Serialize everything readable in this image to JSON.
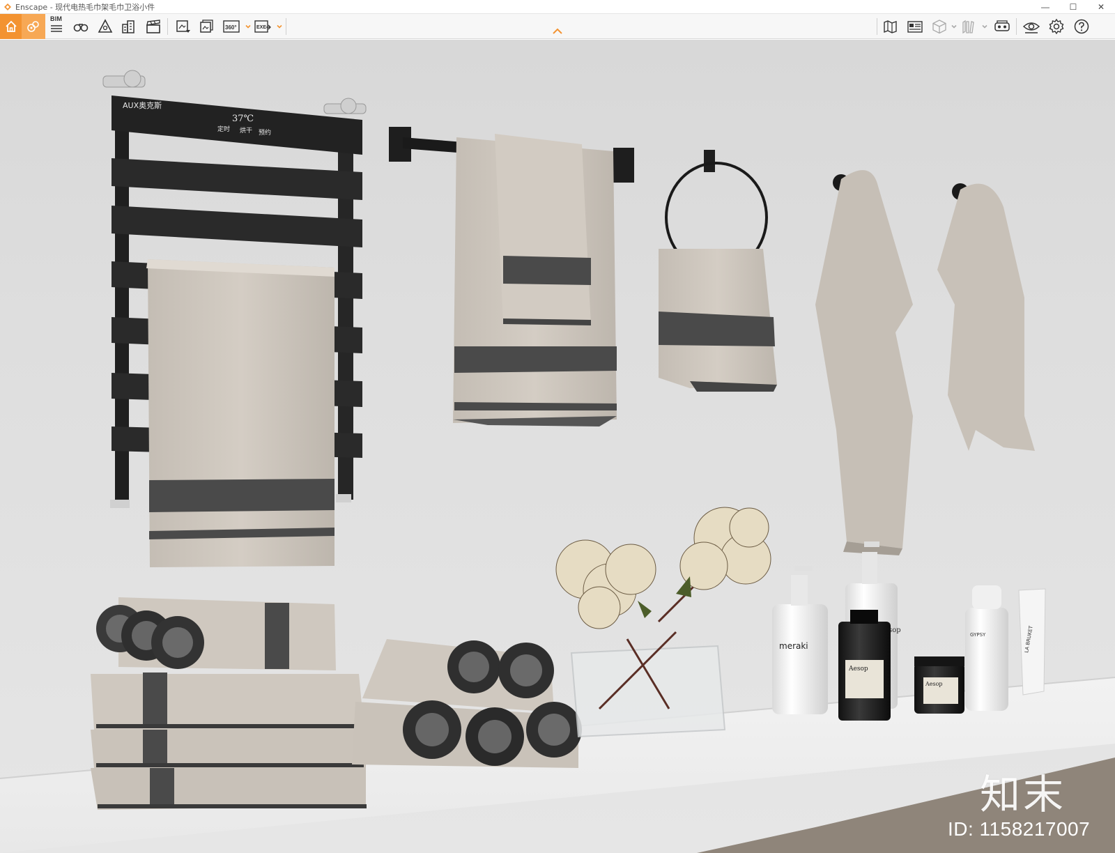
{
  "window": {
    "title": "Enscape - 现代电热毛巾架毛巾卫浴小件",
    "controls": {
      "minimize": "—",
      "maximize": "☐",
      "close": "✕"
    }
  },
  "toolbar": {
    "bim_label": "BIM",
    "panorama_label": "360°",
    "exe_label": "EXE",
    "items_left": [
      "home-icon",
      "asset-library-icon",
      "bim-icon",
      "binoculars-icon",
      "warning-icon",
      "building-icon",
      "clapperboard-icon",
      "screenshot-icon",
      "batch-render-icon",
      "panorama-icon",
      "export-exe-icon"
    ],
    "items_right": [
      "map-icon",
      "tag-icon",
      "cube-icon",
      "books-icon",
      "vr-headset-icon",
      "visibility-icon",
      "settings-icon",
      "help-icon"
    ],
    "accent_color": "#f39331"
  },
  "scene": {
    "radiator": {
      "brand": "AUX奥克斯",
      "temperature": "37℃",
      "buttons": [
        "定时",
        "烘干",
        "预约"
      ]
    },
    "products": [
      "meraki",
      "Aesop",
      "Aesop",
      "Aesop",
      "GYPSY",
      "LA BRUKET"
    ],
    "watermark": {
      "logo_text": "知末",
      "id_text": "ID: 1158217007"
    }
  }
}
